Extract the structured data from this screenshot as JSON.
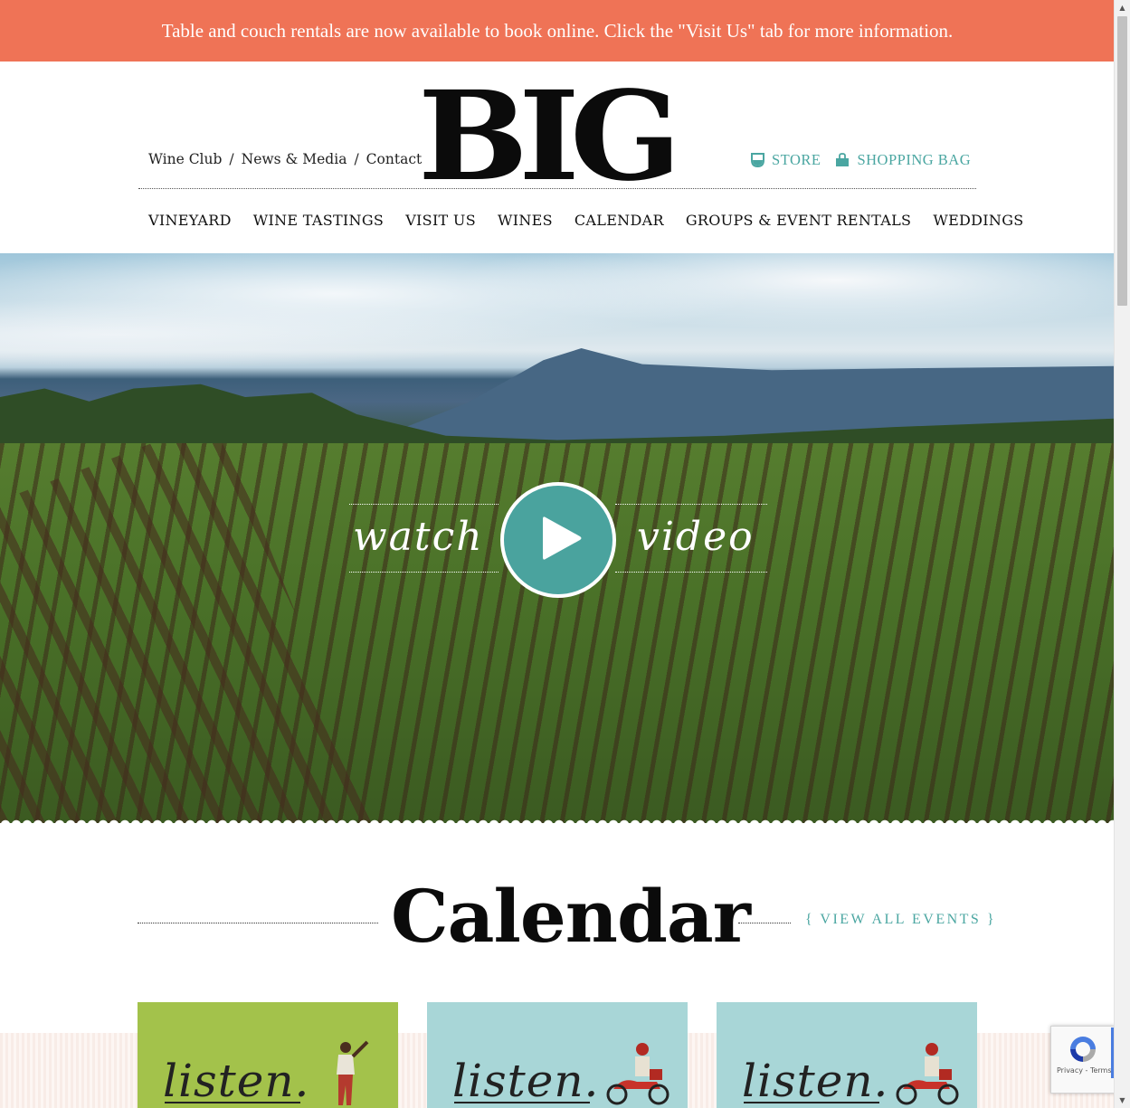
{
  "announcement": {
    "text": "Table and couch rentals are now available to book online. Click the \"Visit Us\" tab for more information."
  },
  "header": {
    "util_nav": [
      "Wine Club",
      "News & Media",
      "Contact"
    ],
    "separator": "/",
    "logo_text": "BIG",
    "store_label": "STORE",
    "bag_label": "SHOPPING BAG",
    "icons": {
      "store": "wine-glass-icon",
      "bag": "shopping-bag-icon"
    }
  },
  "main_nav": {
    "items": [
      "VINEYARD",
      "WINE TASTINGS",
      "VISIT US",
      "WINES",
      "CALENDAR",
      "GROUPS & EVENT RENTALS",
      "WEDDINGS"
    ]
  },
  "hero": {
    "watch_label": "watch",
    "video_label": "video",
    "play_icon": "play-icon"
  },
  "calendar": {
    "title": "Calendar",
    "view_all": "{ VIEW ALL EVENTS }",
    "cards": [
      {
        "text": "listen."
      },
      {
        "text": "listen."
      },
      {
        "text": "listen."
      }
    ]
  },
  "recaptcha": {
    "terms": "Privacy - Terms"
  },
  "colors": {
    "announcement_bg": "#ef7356",
    "accent_teal": "#4aa6a1",
    "card_green": "#a3c24b",
    "card_blue": "#a8d6d7"
  }
}
